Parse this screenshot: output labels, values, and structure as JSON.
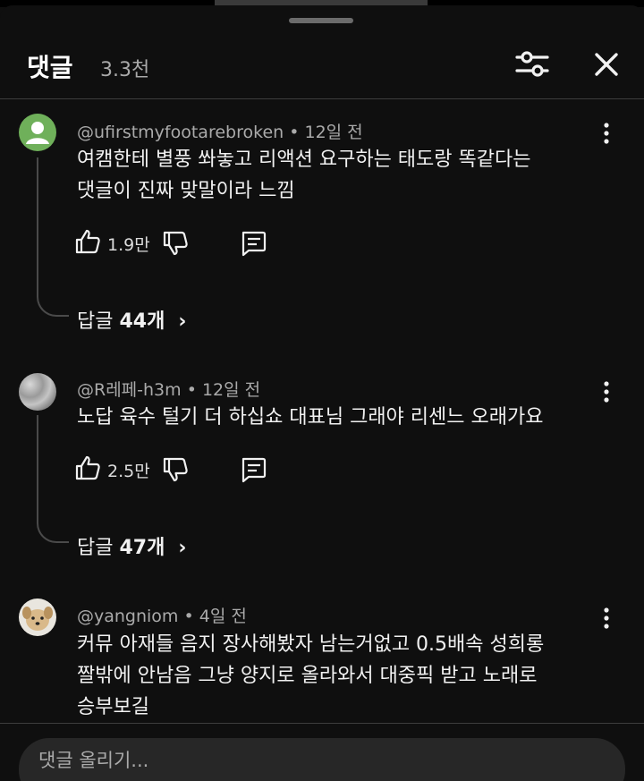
{
  "header": {
    "title": "댓글",
    "count": "3.3천",
    "filter_icon": "sort-filter-icon",
    "close_icon": "close-icon"
  },
  "comments": [
    {
      "author": "@ufirstmyfootarebroken",
      "time": "12일 전",
      "lines": [
        "여캠한테 별풍 쏴놓고 리액션 요구하는 태도랑 똑같다는",
        "댓글이 진짜 맞말이라 느낌"
      ],
      "likes": "1.9만",
      "replies_label": "답글",
      "replies_count": "44개",
      "avatar": "default-green-avatar"
    },
    {
      "author": "@R레페-h3m",
      "time": "12일 전",
      "lines": [
        "노답 육수 털기 더 하십쇼 대표님 그래야 리센느 오래가요"
      ],
      "likes": "2.5만",
      "replies_label": "답글",
      "replies_count": "47개",
      "avatar": "textured-gray-avatar"
    },
    {
      "author": "@yangniom",
      "time": "4일 전",
      "lines": [
        "커뮤 아재들 음지 장사해봤자 남는거없고 0.5배속 성희롱",
        "짤밖에 안남음 그냥 양지로 올라와서 대중픽 받고 노래로",
        "승부보길"
      ],
      "avatar": "puppy-avatar"
    }
  ],
  "input": {
    "placeholder": "댓글 올리기..."
  },
  "colors": {
    "background": "#0f0f0f",
    "text": "#f1f1f1",
    "secondary_text": "#aaaaaa",
    "divider": "#3d3d3d",
    "input_bg": "#272727"
  }
}
